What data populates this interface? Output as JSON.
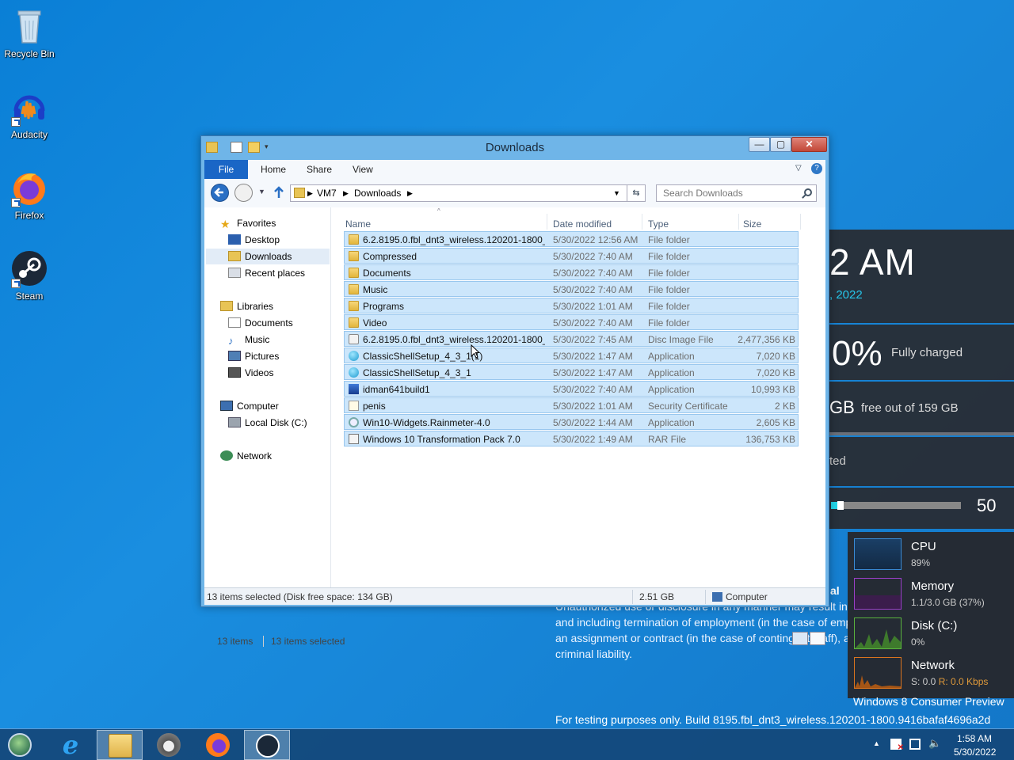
{
  "desktop": {
    "icons": [
      "Recycle Bin",
      "Audacity",
      "Firefox",
      "Steam"
    ]
  },
  "window": {
    "title": "Downloads",
    "controls": {
      "minimize": "—",
      "maximize": "▢",
      "close": "✕"
    },
    "ribbon_tabs": [
      "File",
      "Home",
      "Share",
      "View"
    ],
    "breadcrumb": [
      "VM7",
      "Downloads"
    ],
    "search_placeholder": "Search Downloads",
    "nav_pane": {
      "favorites": "Favorites",
      "favorites_items": [
        "Desktop",
        "Downloads",
        "Recent places"
      ],
      "libraries": "Libraries",
      "libraries_items": [
        "Documents",
        "Music",
        "Pictures",
        "Videos"
      ],
      "computer": "Computer",
      "computer_items": [
        "Local Disk (C:)"
      ],
      "network": "Network"
    },
    "columns": [
      "Name",
      "Date modified",
      "Type",
      "Size"
    ],
    "files": [
      {
        "name": "6.2.8195.0.fbl_dnt3_wireless.120201-1800_...",
        "date": "5/30/2022 12:56 AM",
        "type": "File folder",
        "size": "",
        "icon": "folder"
      },
      {
        "name": "Compressed",
        "date": "5/30/2022 7:40 AM",
        "type": "File folder",
        "size": "",
        "icon": "folder"
      },
      {
        "name": "Documents",
        "date": "5/30/2022 7:40 AM",
        "type": "File folder",
        "size": "",
        "icon": "folder"
      },
      {
        "name": "Music",
        "date": "5/30/2022 7:40 AM",
        "type": "File folder",
        "size": "",
        "icon": "folder"
      },
      {
        "name": "Programs",
        "date": "5/30/2022 1:01 AM",
        "type": "File folder",
        "size": "",
        "icon": "folder"
      },
      {
        "name": "Video",
        "date": "5/30/2022 7:40 AM",
        "type": "File folder",
        "size": "",
        "icon": "folder"
      },
      {
        "name": "6.2.8195.0.fbl_dnt3_wireless.120201-1800_...",
        "date": "5/30/2022 7:45 AM",
        "type": "Disc Image File",
        "size": "2,477,356 KB",
        "icon": "disc"
      },
      {
        "name": "ClassicShellSetup_4_3_1(1)",
        "date": "5/30/2022 1:47 AM",
        "type": "Application",
        "size": "7,020 KB",
        "icon": "app"
      },
      {
        "name": "ClassicShellSetup_4_3_1",
        "date": "5/30/2022 1:47 AM",
        "type": "Application",
        "size": "7,020 KB",
        "icon": "app"
      },
      {
        "name": "idman641build1",
        "date": "5/30/2022 7:40 AM",
        "type": "Application",
        "size": "10,993 KB",
        "icon": "idm"
      },
      {
        "name": "penis",
        "date": "5/30/2022 1:01 AM",
        "type": "Security Certificate",
        "size": "2 KB",
        "icon": "cert"
      },
      {
        "name": "Win10-Widgets.Rainmeter-4.0",
        "date": "5/30/2022 1:44 AM",
        "type": "Application",
        "size": "2,605 KB",
        "icon": "rain"
      },
      {
        "name": "Windows 10 Transformation Pack 7.0",
        "date": "5/30/2022 1:49 AM",
        "type": "RAR File",
        "size": "136,753 KB",
        "icon": "rar"
      }
    ],
    "item_count": "13 items",
    "selected_count": "13 items selected",
    "statusbar": {
      "details": "13 items selected (Disk free space: 134 GB)",
      "size": "2.51 GB",
      "location": "Computer"
    }
  },
  "widgets": {
    "clock_time": "2 AM",
    "clock_date": ", 2022",
    "battery_pct": "0%",
    "battery_status": "Fully charged",
    "disk_size": "GB",
    "disk_free": "free out of 159 GB",
    "updates": "ted",
    "volume_value": "50",
    "volume_level": 0.3,
    "perf": [
      {
        "name": "CPU",
        "value": "89%",
        "color": "#3a8bd6"
      },
      {
        "name": "Memory",
        "value": "1.1/3.0 GB (37%)",
        "color": "#9b3fc9"
      },
      {
        "name": "Disk (C:)",
        "value": "0%",
        "color": "#5ab33e"
      },
      {
        "name": "Network",
        "value_s": "S: 0.0",
        "value_r": "R: 0.0 Kbps",
        "color": "#d9741f"
      }
    ]
  },
  "legal": {
    "heading_fragment": "al",
    "line1": "Unauthorized use or disclosure in any manner may result in disciplinary action up to",
    "line2": "and including termination of employment (in the case of employees), termination of",
    "line3": "an assignment or contract (in the case of contingent staff), and potential civil and",
    "line4": "criminal liability."
  },
  "watermark": {
    "edition": "Windows 8 Consumer Preview",
    "build": "For testing purposes only. Build 8195.fbl_dnt3_wireless.120201-1800.9416bafaf4696a2d"
  },
  "taskbar": {
    "time": "1:58 AM",
    "date": "5/30/2022"
  }
}
